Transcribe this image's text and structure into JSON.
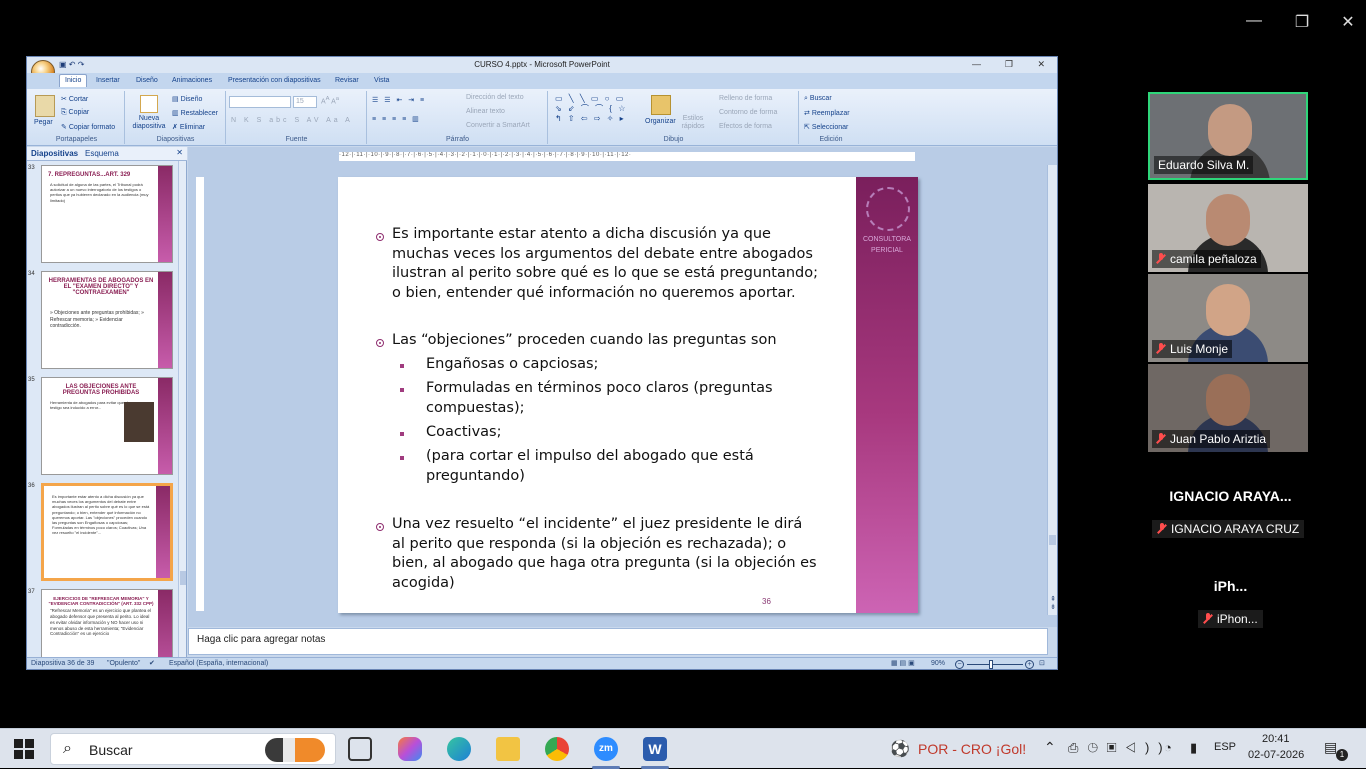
{
  "zoom_window": {
    "minimize": "—",
    "restore": "❐",
    "close": "✕"
  },
  "ppt": {
    "title": "CURSO 4.pptx - Microsoft PowerPoint",
    "tabs": [
      "Inicio",
      "Insertar",
      "Diseño",
      "Animaciones",
      "Presentación con diapositivas",
      "Revisar",
      "Vista"
    ],
    "ribbon": {
      "portapapeles": {
        "label": "Portapapeles",
        "pegar": "Pegar",
        "cortar": "Cortar",
        "copiar": "Copiar",
        "copiar_formato": "Copiar formato"
      },
      "diapositivas": {
        "label": "Diapositivas",
        "nueva": "Nueva diapositiva",
        "diseno": "Diseño",
        "restablecer": "Restablecer",
        "eliminar": "Eliminar"
      },
      "fuente": {
        "label": "Fuente",
        "size": "15"
      },
      "parrafo": {
        "label": "Párrafo",
        "direccion": "Dirección del texto",
        "alinear": "Alinear texto",
        "smartart": "Convertir a SmartArt"
      },
      "dibujo": {
        "label": "Dibujo",
        "organizar": "Organizar",
        "estilos": "Estilos rápidos",
        "relleno": "Relleno de forma",
        "contorno": "Contorno de forma",
        "efectos": "Efectos de forma"
      },
      "edicion": {
        "label": "Edición",
        "buscar": "Buscar",
        "reemplazar": "Reemplazar",
        "seleccionar": "Seleccionar"
      }
    },
    "left_tabs": {
      "diapositivas": "Diapositivas",
      "esquema": "Esquema"
    },
    "thumbs": [
      {
        "num": "33",
        "title": "7. REPREGUNTAS...ART. 329",
        "body": "A solicitud de alguna de las partes, el Tribunal podrá autorizar a un nuevo interrogatorio de los testigos o peritos que ya hubieren declarado en la audiencia (muy limitado)"
      },
      {
        "num": "34",
        "title": "HERRAMIENTAS DE ABOGADOS EN EL \"EXAMEN DIRECTO\" Y \"CONTRAEXAMEN\"",
        "body": "» Objeciones ante preguntas prohibidas; » Refrescar memoria; » Evidenciar contradicción."
      },
      {
        "num": "35",
        "title": "LAS OBJECIONES ANTE PREGUNTAS PROHIBIDAS",
        "body": "Herramienta de abogados para evitar que el testigo sea inducido a error..."
      },
      {
        "num": "36",
        "title": "",
        "body": "Es importante estar atento a dicha discusión ya que muchas veces los argumentos del debate entre abogados ilustran al perito sobre qué es lo que se está preguntando; o bien, entender qué información no queremos aportar. Las \"objeciones\" proceden cuando las preguntas son Engañosas o capciosas; Formuladas en términos poco claros; Coactivas; Una vez resuelto \"el incidente\"..."
      },
      {
        "num": "37",
        "title": "EJERCICIOS DE \"REFRESCAR MEMORIA\" Y \"EVIDENCIAR CONTRADICCIÓN\" (ART. 332 CPP)",
        "body": "\"Refrescar Memoria\" es un ejercicio que plantea el abogado defensor que presenta al perito. Lo ideal es evitar olvidar información y NO hacer uso ni menos abuso de esta herramienta; \"Evidenciar Contradicción\" es un ejercicio"
      }
    ],
    "slide": {
      "bullet1": "Es importante estar atento a dicha discusión ya que muchas veces los argumentos del debate entre abogados ilustran al perito sobre qué es lo que se está preguntando; o bien, entender qué información no queremos aportar.",
      "bullet1_lines": [
        "Es importante estar atento a dicha discusión ya que",
        "muchas veces los argumentos del debate entre abogados",
        "ilustran al perito sobre qué es lo que se está preguntando;",
        "o bien, entender qué información no queremos aportar."
      ],
      "bullet2": "Las “objeciones” proceden cuando las preguntas son",
      "sub1": "Engañosas o capciosas;",
      "sub2_lines": [
        "Formuladas en términos poco claros (preguntas",
        "compuestas);"
      ],
      "sub3": "Coactivas;",
      "sub4_lines": [
        "(para cortar el impulso del abogado que está",
        "preguntando)"
      ],
      "bullet3_lines": [
        "Una vez resuelto “el incidente” el juez presidente le dirá",
        "al perito que responda (si la objeción es rechazada); o",
        "bien, al abogado que haga otra pregunta (si la objeción es",
        "acogida)"
      ],
      "brand": "CONSULTORA PERICIAL",
      "number": "36"
    },
    "ruler": "·12·|·11·|·10·|·9·|·8·|·7·|·6·|·5·|·4·|·3·|·2·|·1·|·0·|·1·|·2·|·3·|·4·|·5·|·6·|·7·|·8·|·9·|·10·|·11·|·12·",
    "notes_placeholder": "Haga clic para agregar notas",
    "status": {
      "slide": "Diapositiva 36 de 39",
      "theme": "\"Opulento\"",
      "lang": "Español (España, internacional)",
      "zoom": "90%"
    }
  },
  "participants": [
    {
      "name": "Eduardo Silva M.",
      "muted": false,
      "active": true,
      "bg": "#6d7074",
      "shirt": "#3a3a3a",
      "skin": "#c49a82"
    },
    {
      "name": "camila peñaloza",
      "muted": true,
      "active": false,
      "bg": "#b9b5b0",
      "shirt": "#2a2a2a",
      "skin": "#b98a72"
    },
    {
      "name": "Luis Monje",
      "muted": true,
      "active": false,
      "bg": "#8d8a86",
      "shirt": "#3b4c72",
      "skin": "#d1a487"
    },
    {
      "name": "Juan Pablo Ariztia",
      "muted": true,
      "active": false,
      "bg": "#6f6864",
      "shirt": "#2d3650",
      "skin": "#9a6f58"
    }
  ],
  "extra_participants": [
    {
      "big": "IGNACIO ARAYA...",
      "small": "IGNACIO ARAYA CRUZ"
    },
    {
      "big": "iPh...",
      "small": "iPhon..."
    }
  ],
  "taskbar": {
    "search": "Buscar",
    "news": "POR - CRO ¡Gol!",
    "lang": "ESP",
    "time": "20:41",
    "date": "02-07-2026",
    "notif": "1"
  }
}
